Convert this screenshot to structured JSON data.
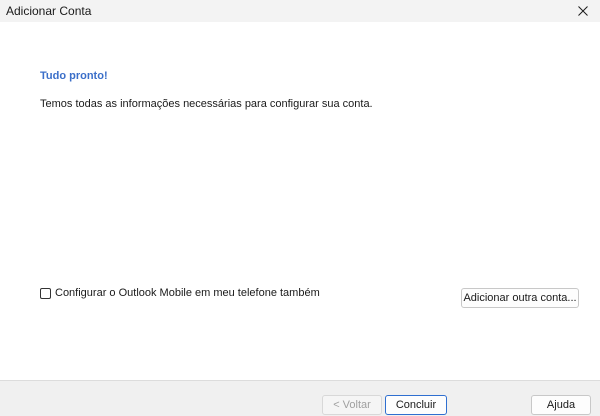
{
  "window": {
    "title": "Adicionar Conta",
    "close_icon": "close-icon"
  },
  "main": {
    "heading": "Tudo pronto!",
    "message": "Temos todas as informações necessárias para configurar sua conta.",
    "mobile_checkbox": {
      "label": "Configurar o Outlook Mobile em meu telefone também",
      "checked": false
    },
    "add_account_label": "Adicionar outra conta..."
  },
  "footer": {
    "back_label": "< Voltar",
    "back_enabled": false,
    "finish_label": "Concluir",
    "help_label": "Ajuda"
  },
  "colors": {
    "heading": "#3b6fc9",
    "default_button_border": "#2f6fd0",
    "footer_bg": "#f0f0f0"
  }
}
